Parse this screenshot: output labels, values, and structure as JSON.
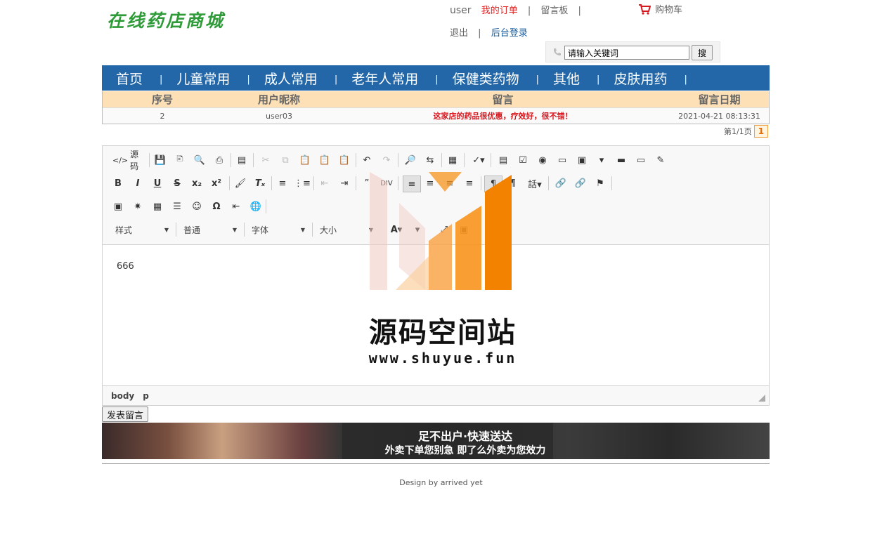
{
  "header": {
    "logo": "在线药店商城",
    "username": "user",
    "my_orders": "我的订单",
    "message_board": "留言板",
    "cart": "购物车",
    "logout": "退出",
    "admin_login": "后台登录",
    "search": {
      "value": "请输入关键词",
      "button": "搜"
    }
  },
  "nav": [
    "首页",
    "儿童常用",
    "成人常用",
    "老年人常用",
    "保健类药物",
    "其他",
    "皮肤用药"
  ],
  "messages": {
    "columns": [
      "序号",
      "用户昵称",
      "留言",
      "留言日期"
    ],
    "rows": [
      {
        "id": "2",
        "user": "user03",
        "text": "这家店的药品很优惠，疗效好，很不错！",
        "date": "2021-04-21 08:13:31"
      }
    ]
  },
  "pager": {
    "info": "第1/1页",
    "current": "1"
  },
  "editor": {
    "source_label": "源码",
    "combos": {
      "style": "样式",
      "format": "普通",
      "font": "字体",
      "size": "大小"
    },
    "content": "666",
    "status_path": [
      "body",
      "p"
    ]
  },
  "post_button": "发表留言",
  "banner": {
    "title": "足不出户·快速送达",
    "subtitle": "外卖下单您别急 即了么外卖为您效力"
  },
  "footer": "Design by arrived yet",
  "watermark": {
    "title": "源码空间站",
    "url": "www.shuyue.fun"
  },
  "colors": {
    "nav": "#2367a8",
    "table_head": "#fde0b5",
    "accent_red": "#d8171d",
    "logo_green": "#2e9b38",
    "watermark_orange": "#f7941d"
  }
}
